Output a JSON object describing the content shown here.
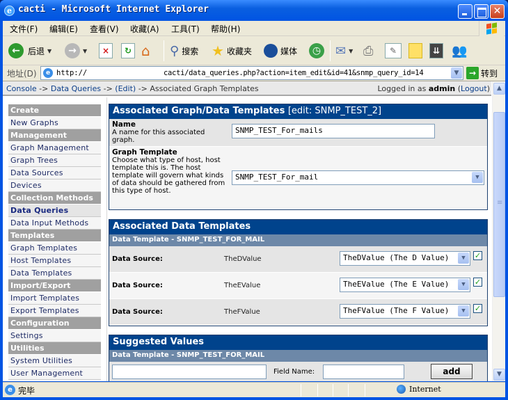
{
  "window": {
    "title": "cacti - Microsoft Internet Explorer",
    "controls": [
      "minimize",
      "maximize",
      "close"
    ]
  },
  "menubar": {
    "items": [
      "文件(F)",
      "编辑(E)",
      "查看(V)",
      "收藏(A)",
      "工具(T)",
      "帮助(H)"
    ]
  },
  "toolbar": {
    "back_label": "后退",
    "search_label": "搜索",
    "favorites_label": "收藏夹",
    "media_label": "媒体"
  },
  "address": {
    "label": "地址(D)",
    "url_scheme": "http://",
    "url_path": "cacti/data_queries.php?action=item_edit&id=41&snmp_query_id=14",
    "go_label": "转到"
  },
  "breadcrumb": {
    "items": [
      "Console",
      "Data Queries",
      "(Edit)"
    ],
    "separator": "->",
    "current": "Associated Graph Templates",
    "login_prefix": "Logged in as",
    "user": "admin",
    "logout_label": "Logout"
  },
  "sidebar": {
    "sections": [
      {
        "header": "Create",
        "items": [
          "New Graphs"
        ]
      },
      {
        "header": "Management",
        "items": [
          "Graph Management",
          "Graph Trees",
          "Data Sources",
          "Devices"
        ]
      },
      {
        "header": "Collection Methods",
        "items": [
          "Data Queries",
          "Data Input Methods"
        ]
      },
      {
        "header": "Templates",
        "items": [
          "Graph Templates",
          "Host Templates",
          "Data Templates"
        ]
      },
      {
        "header": "Import/Export",
        "items": [
          "Import Templates",
          "Export Templates"
        ]
      },
      {
        "header": "Configuration",
        "items": [
          "Settings"
        ]
      },
      {
        "header": "Utilities",
        "items": [
          "System Utilities",
          "User Management"
        ]
      }
    ],
    "selected": "Data Queries"
  },
  "assoc_panel": {
    "title": "Associated Graph/Data Templates",
    "subtitle": "[edit: SNMP_TEST_2]",
    "name_label": "Name",
    "name_desc": "A name for this associated graph.",
    "name_value": "SNMP_TEST_For_mails",
    "template_label": "Graph Template",
    "template_desc": "Choose what type of host, host template this is. The host template will govern what kinds of data should be gathered from this type of host.",
    "template_value": "SNMP_TEST_For_mail"
  },
  "data_templates_panel": {
    "title": "Associated Data Templates",
    "subheader": "Data Template - SNMP_TEST_FOR_MAIL",
    "rows": [
      {
        "label": "Data Source:",
        "name": "TheDValue",
        "selected": "TheDValue (The D Value)",
        "checked": true
      },
      {
        "label": "Data Source:",
        "name": "TheEValue",
        "selected": "TheEValue (The E Value)",
        "checked": true
      },
      {
        "label": "Data Source:",
        "name": "TheFValue",
        "selected": "TheFValue (The F Value)",
        "checked": true
      }
    ]
  },
  "suggested_panel": {
    "title": "Suggested Values",
    "subheader": "Data Template - SNMP_TEST_FOR_MAIL",
    "value_input": "",
    "field_name_label": "Field Name:",
    "field_name_input": "",
    "add_label": "add"
  },
  "statusbar": {
    "status": "完毕",
    "zone": "Internet"
  }
}
